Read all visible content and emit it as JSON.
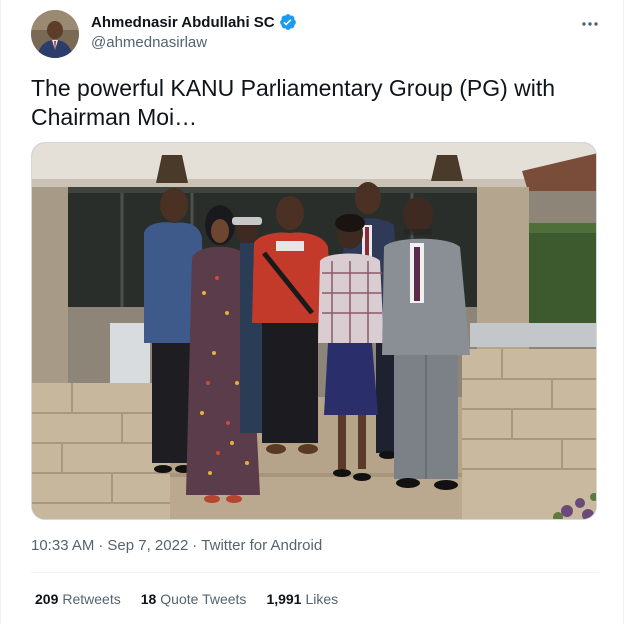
{
  "tweet": {
    "author": {
      "display_name": "Ahmednasir Abdullahi SC",
      "handle": "@ahmednasirlaw",
      "verified_icon": "verified-badge-icon",
      "verified_color": "#1d9bf0"
    },
    "more_icon": "more-options-icon",
    "text": "The powerful KANU Parliamentary Group (PG) with Chairman Moi…",
    "media": {
      "type": "photo",
      "subject": "Group photo of seven people on a veranda"
    },
    "time": "10:33 AM",
    "separator": "·",
    "date": "Sep 7, 2022",
    "source": "Twitter for Android",
    "stats": [
      {
        "count": "209",
        "label": "Retweets"
      },
      {
        "count": "18",
        "label": "Quote Tweets"
      },
      {
        "count": "1,991",
        "label": "Likes"
      }
    ]
  },
  "colors": {
    "text_primary": "#0f1419",
    "text_secondary": "#536471",
    "border": "#eff3f4",
    "accent": "#1d9bf0"
  }
}
